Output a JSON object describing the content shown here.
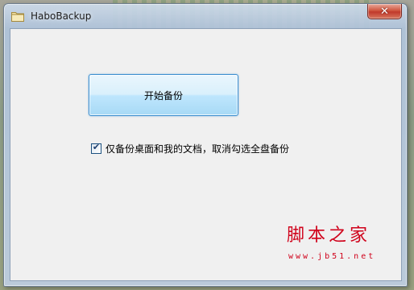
{
  "window": {
    "title": "HaboBackup",
    "close_glyph": "✕",
    "app_icon": "folder-icon"
  },
  "main": {
    "start_button_label": "开始备份",
    "desktop_docs_only": {
      "checked": true,
      "label": "仅备份桌面和我的文档，取消勾选全盘备份"
    }
  },
  "watermark": {
    "logo": "脚本之家",
    "url": "www.jb51.net"
  },
  "colors": {
    "accent_border": "#3c8fd0",
    "close_red": "#c0392b",
    "watermark_red": "#d0021b"
  }
}
